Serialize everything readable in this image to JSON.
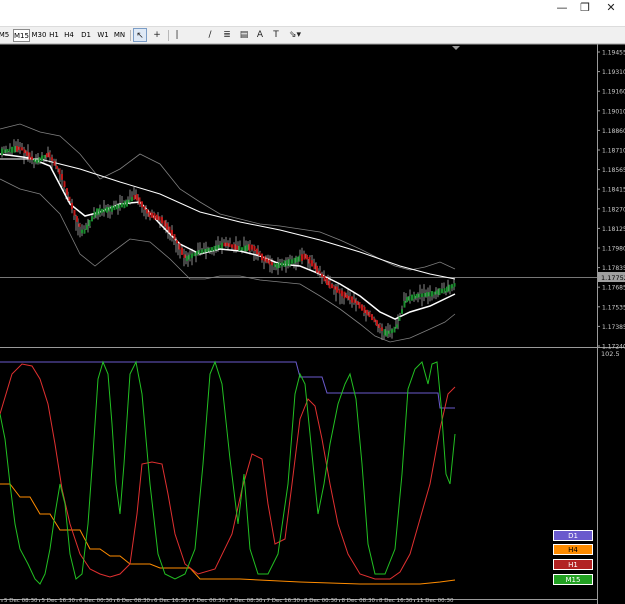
{
  "window": {
    "minimize_glyph": "—",
    "restore_glyph": "❐",
    "close_glyph": "✕"
  },
  "toolbar": {
    "timeframes": [
      "M5",
      "M15",
      "M30",
      "H1",
      "H4",
      "D1",
      "W1",
      "MN"
    ],
    "active_timeframe": "M15",
    "tools": [
      {
        "name": "cursor-icon",
        "glyph": "↖",
        "active": true
      },
      {
        "name": "crosshair-icon",
        "glyph": "+",
        "active": false
      },
      {
        "name": "vertical-line-icon",
        "glyph": "|",
        "active": false
      },
      {
        "name": "trendline-icon",
        "glyph": "/",
        "active": false
      },
      {
        "name": "fibonacci-icon",
        "glyph": "≣",
        "active": false
      },
      {
        "name": "channel-icon",
        "glyph": "▤",
        "active": false
      },
      {
        "name": "text-icon",
        "glyph": "A",
        "active": false
      },
      {
        "name": "label-icon",
        "glyph": "T",
        "active": false
      },
      {
        "name": "shapes-icon",
        "glyph": "⇘▾",
        "active": false
      }
    ]
  },
  "price_axis": {
    "labels": [
      "1.19455",
      "1.19310",
      "1.19160",
      "1.19010",
      "1.18860",
      "1.18710",
      "1.18565",
      "1.18415",
      "1.18270",
      "1.18125",
      "1.17980",
      "1.17835",
      "1.17685",
      "1.17535",
      "1.17385",
      "1.17240"
    ],
    "current_price": "1.17752",
    "current_price_color": "#a0a0a0"
  },
  "indicator_axis": {
    "top_label": "102.5"
  },
  "time_axis": {
    "labels": [
      "5 Dec 08:30",
      "5 Dec 16:30",
      "6 Dec 00:30",
      "6 Dec 08:30",
      "6 Dec 16:30",
      "7 Dec 00:30",
      "7 Dec 08:30",
      "7 Dec 16:30",
      "8 Dec 00:30",
      "8 Dec 08:30",
      "8 Dec 16:30",
      "11 Dec 00:30"
    ]
  },
  "legend": [
    {
      "label": "D1",
      "color": "#6a5acd",
      "text_color": "#ffffff"
    },
    {
      "label": "H4",
      "color": "#ff8c00",
      "text_color": "#000000"
    },
    {
      "label": "H1",
      "color": "#b22222",
      "text_color": "#ffffff"
    },
    {
      "label": "M15",
      "color": "#22a022",
      "text_color": "#ffffff"
    }
  ],
  "colors": {
    "background": "#000000",
    "candle_up": "#1a8c2e",
    "candle_down": "#c01818",
    "grey_bars": "#8a8a8a",
    "envelope": "#808080",
    "ma_fast": "#ffffff",
    "d1_line": "#6a5acd",
    "h4_line": "#ff8c00",
    "h1_line": "#e03030",
    "m15_line": "#22c022",
    "separator": "#9a9a9a"
  }
}
